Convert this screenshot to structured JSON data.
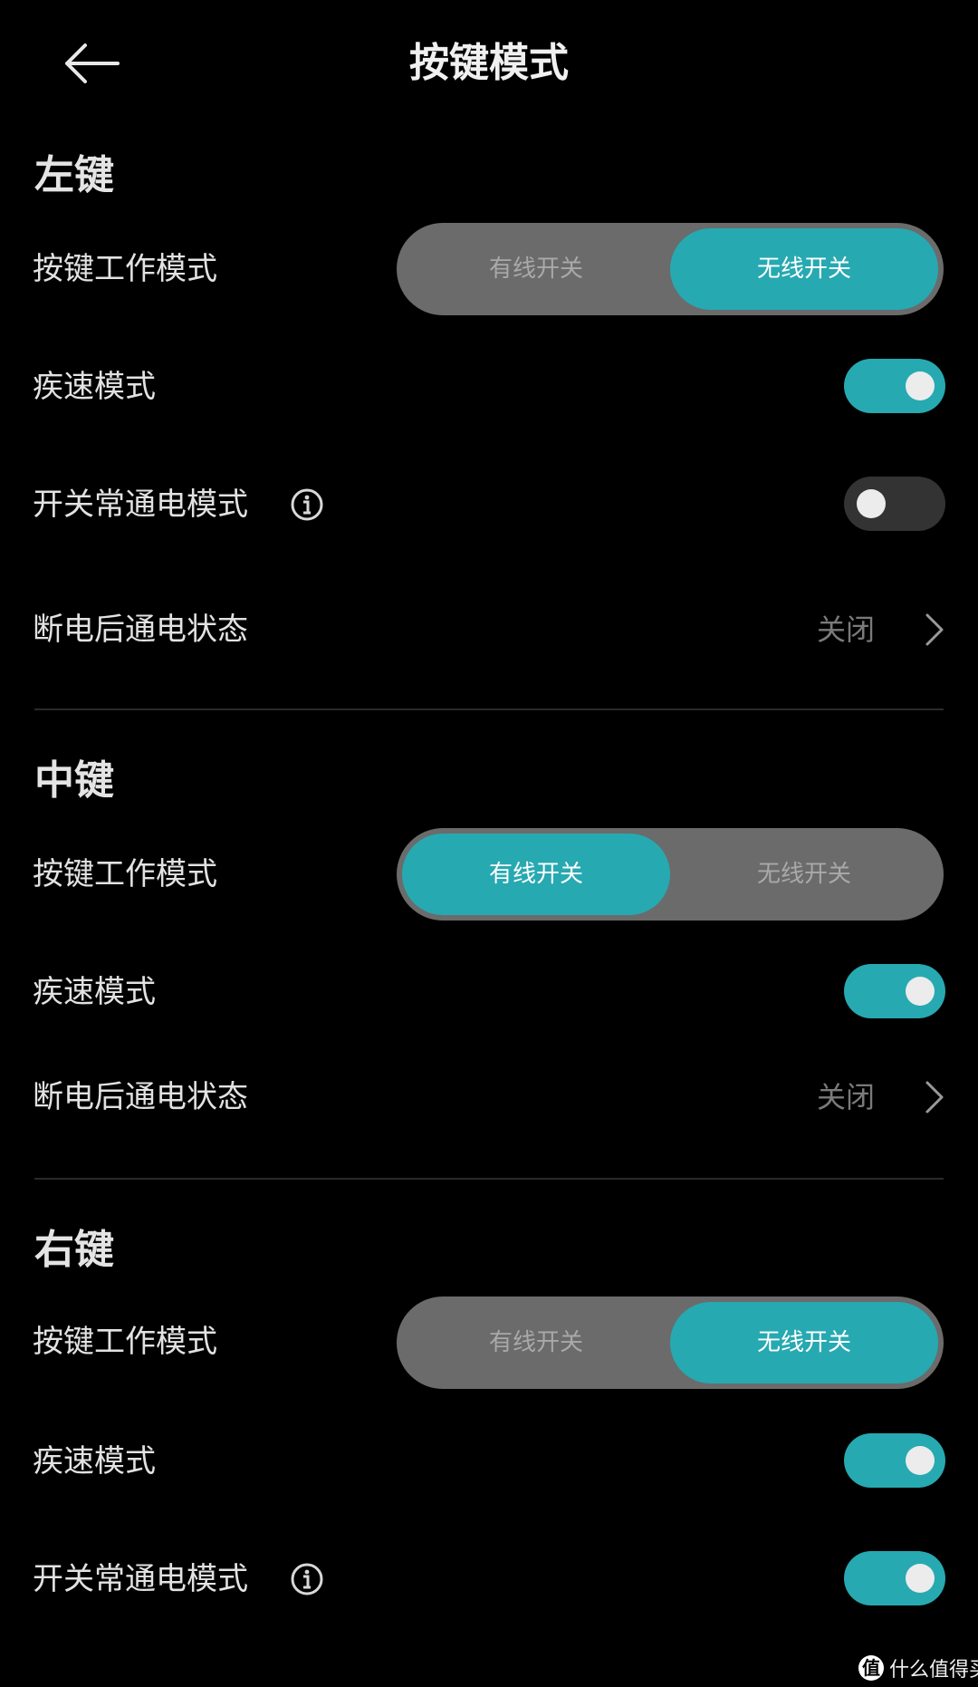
{
  "header": {
    "title": "按键模式",
    "back_icon": "arrow-left-icon"
  },
  "colors": {
    "background": "#000000",
    "accent": "#27a9b1",
    "segment_bg": "#6b6b6b",
    "toggle_off": "#333333",
    "secondary_text": "#7a7a7a"
  },
  "sections": [
    {
      "title": "左键",
      "work_mode": {
        "label": "按键工作模式",
        "options": [
          "有线开关",
          "无线开关"
        ],
        "selected": "无线开关"
      },
      "fast_mode": {
        "label": "疾速模式",
        "on": true
      },
      "always_on_mode": {
        "label": "开关常通电模式",
        "on": false,
        "info_icon": "info-circle-icon"
      },
      "power_restore": {
        "label": "断电后通电状态",
        "value": "关闭",
        "icon": "chevron-right-icon"
      }
    },
    {
      "title": "中键",
      "work_mode": {
        "label": "按键工作模式",
        "options": [
          "有线开关",
          "无线开关"
        ],
        "selected": "有线开关"
      },
      "fast_mode": {
        "label": "疾速模式",
        "on": true
      },
      "power_restore": {
        "label": "断电后通电状态",
        "value": "关闭",
        "icon": "chevron-right-icon"
      }
    },
    {
      "title": "右键",
      "work_mode": {
        "label": "按键工作模式",
        "options": [
          "有线开关",
          "无线开关"
        ],
        "selected": "无线开关"
      },
      "fast_mode": {
        "label": "疾速模式",
        "on": true
      },
      "always_on_mode": {
        "label": "开关常通电模式",
        "on": true,
        "info_icon": "info-circle-icon"
      }
    }
  ],
  "watermark": {
    "logo": "值",
    "text": "什么值得买"
  }
}
